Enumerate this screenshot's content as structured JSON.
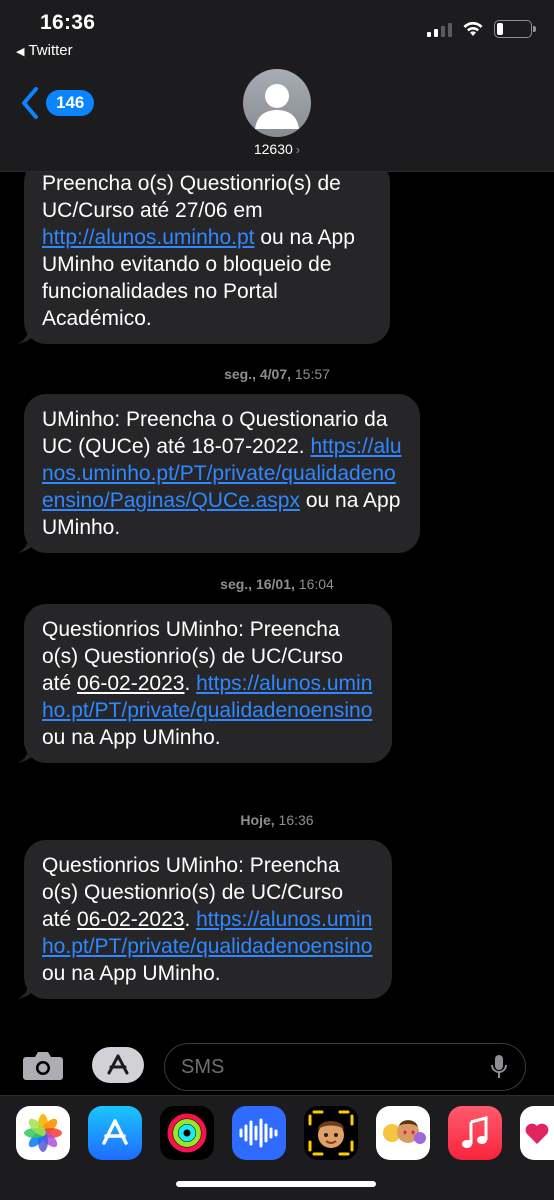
{
  "status_bar": {
    "time": "16:36",
    "back_app": "Twitter"
  },
  "header": {
    "unread_count": "146",
    "contact": "12630",
    "contact_arrow": "›"
  },
  "messages": [
    {
      "segments": [
        {
          "text": "Preencha o(s) Questionrio(s) de UC/Curso até 27/06 em ",
          "type": "text"
        },
        {
          "text": "http://alunos.uminho.pt",
          "type": "link"
        },
        {
          "text": " ou na App UMinho evitando o bloqueio de funcionalidades no Portal Académico.",
          "type": "text"
        }
      ]
    },
    {
      "timestamp_day": "seg., 4/07,",
      "timestamp_time": " 15:57",
      "segments": [
        {
          "text": "UMinho: Preencha o Questionario da UC (QUCe) até 18-07-2022. ",
          "type": "text"
        },
        {
          "text": "https://alunos.uminho.pt/PT/private/qualidadenoensino/Paginas/QUCe.aspx",
          "type": "link"
        },
        {
          "text": " ou na App UMinho.",
          "type": "text"
        }
      ]
    },
    {
      "timestamp_day": "seg., 16/01,",
      "timestamp_time": " 16:04",
      "segments": [
        {
          "text": "Questionrios UMinho: Preencha o(s) Questionrio(s) de UC/Curso até ",
          "type": "text"
        },
        {
          "text": "06-02-2023",
          "type": "underline"
        },
        {
          "text": ". ",
          "type": "text"
        },
        {
          "text": "https://alunos.uminho.pt/PT/private/qualidadenoensino",
          "type": "link"
        },
        {
          "text": " ou na App UMinho.",
          "type": "text"
        }
      ]
    },
    {
      "timestamp_day": "Hoje,",
      "timestamp_time": " 16:36",
      "segments": [
        {
          "text": "Questionrios UMinho: Preencha o(s) Questionrio(s) de UC/Curso até ",
          "type": "text"
        },
        {
          "text": "06-02-2023",
          "type": "underline"
        },
        {
          "text": ". ",
          "type": "text"
        },
        {
          "text": "https://alunos.uminho.pt/PT/private/qualidadenoensino",
          "type": "link"
        },
        {
          "text": " ou na App UMinho.",
          "type": "text"
        }
      ]
    }
  ],
  "composer": {
    "placeholder": "SMS"
  },
  "app_drawer": [
    "photos-icon",
    "app-store-icon",
    "activity-icon",
    "audio-message-icon",
    "memoji-icon",
    "memoji-stickers-icon",
    "music-icon",
    "heart-app-icon"
  ],
  "colors": {
    "accent": "#0a84ff",
    "link": "#2f88ff",
    "bubble": "#262628",
    "header": "#1c1c1e"
  }
}
